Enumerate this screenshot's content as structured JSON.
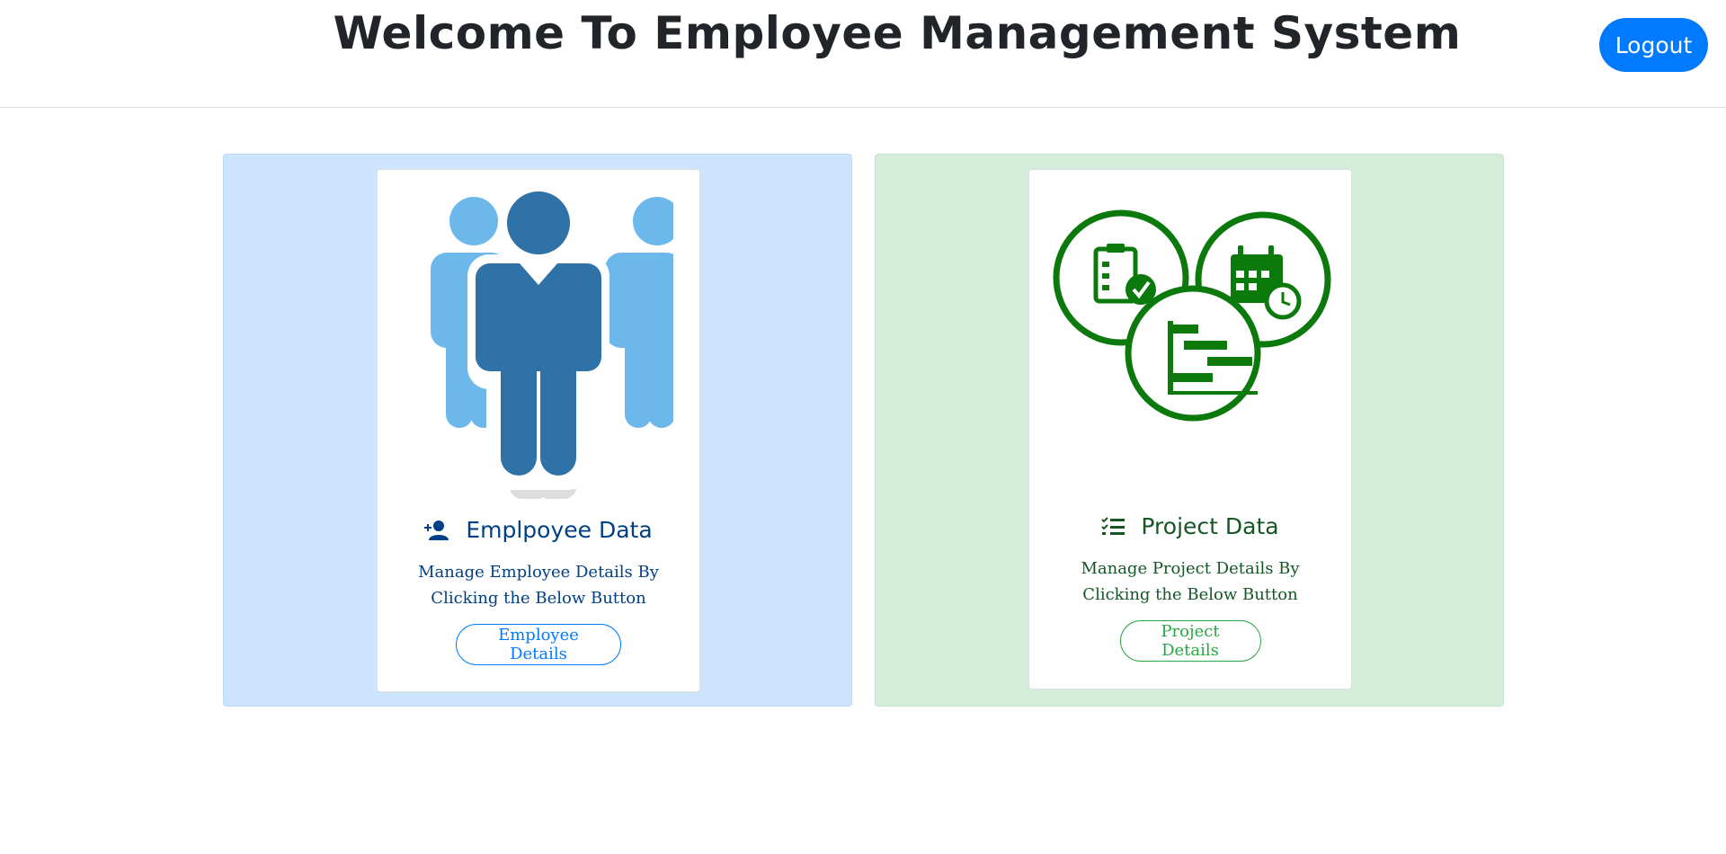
{
  "header": {
    "title": "Welcome To Employee Management System",
    "logout_label": "Logout"
  },
  "cards": {
    "employee": {
      "title": "Emplpoyee Data",
      "icon": "person-add-icon",
      "description": "Manage Employee Details By Clicking the Below Button",
      "button_label": "Employee Details",
      "image": "employees-group-icon",
      "panel_color": "#cce5fc",
      "accent_color": "#007bff"
    },
    "project": {
      "title": "Project Data",
      "icon": "checklist-icon",
      "description": "Manage Project Details By Clicking the Below Button",
      "button_label": "Project Details",
      "image": "project-planning-icon",
      "panel_color": "#d4edda",
      "accent_color": "#28a745"
    }
  }
}
